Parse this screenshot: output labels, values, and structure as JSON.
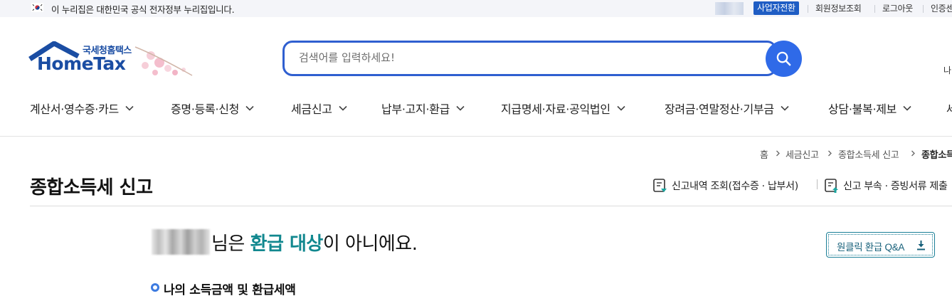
{
  "gov_bar": {
    "notice": "이 누리집은 대한민국 공식 전자정부 누리집입니다.",
    "switch_label": "사업자전환",
    "links": [
      "회원정보조회",
      "로그아웃",
      "인증센터"
    ]
  },
  "logo": {
    "sub": "국세청홈택스",
    "main": "HomeTax"
  },
  "search": {
    "placeholder": "검색어를 입력하세요!",
    "value": ""
  },
  "header_right_text": "나",
  "gnb": [
    {
      "label": "계산서·영수증·카드"
    },
    {
      "label": "증명·등록·신청"
    },
    {
      "label": "세금신고"
    },
    {
      "label": "납부·고지·환급"
    },
    {
      "label": "지급명세·자료·공익법인"
    },
    {
      "label": "장려금·연말정산·기부금"
    },
    {
      "label": "상담·불복·제보"
    },
    {
      "label": "세"
    }
  ],
  "breadcrumb": [
    "홈",
    "세금신고",
    "종합소득세 신고",
    "종합소득세"
  ],
  "page": {
    "title": "종합소득세 신고",
    "util_links": [
      "신고내역 조회(접수증 · 납부서)",
      "신고 부속 · 증빙서류 제출"
    ]
  },
  "result": {
    "prefix": "님은 ",
    "highlight": "환급 대상",
    "suffix": "이 아니에요."
  },
  "qa_button": {
    "label": "원클릭 환급 Q&A"
  },
  "section": {
    "title": "나의 소득금액 및 환급세액"
  },
  "colors": {
    "brand_blue": "#1a4da3",
    "search_border": "#2f5fd0",
    "accent_teal": "#12888f"
  }
}
